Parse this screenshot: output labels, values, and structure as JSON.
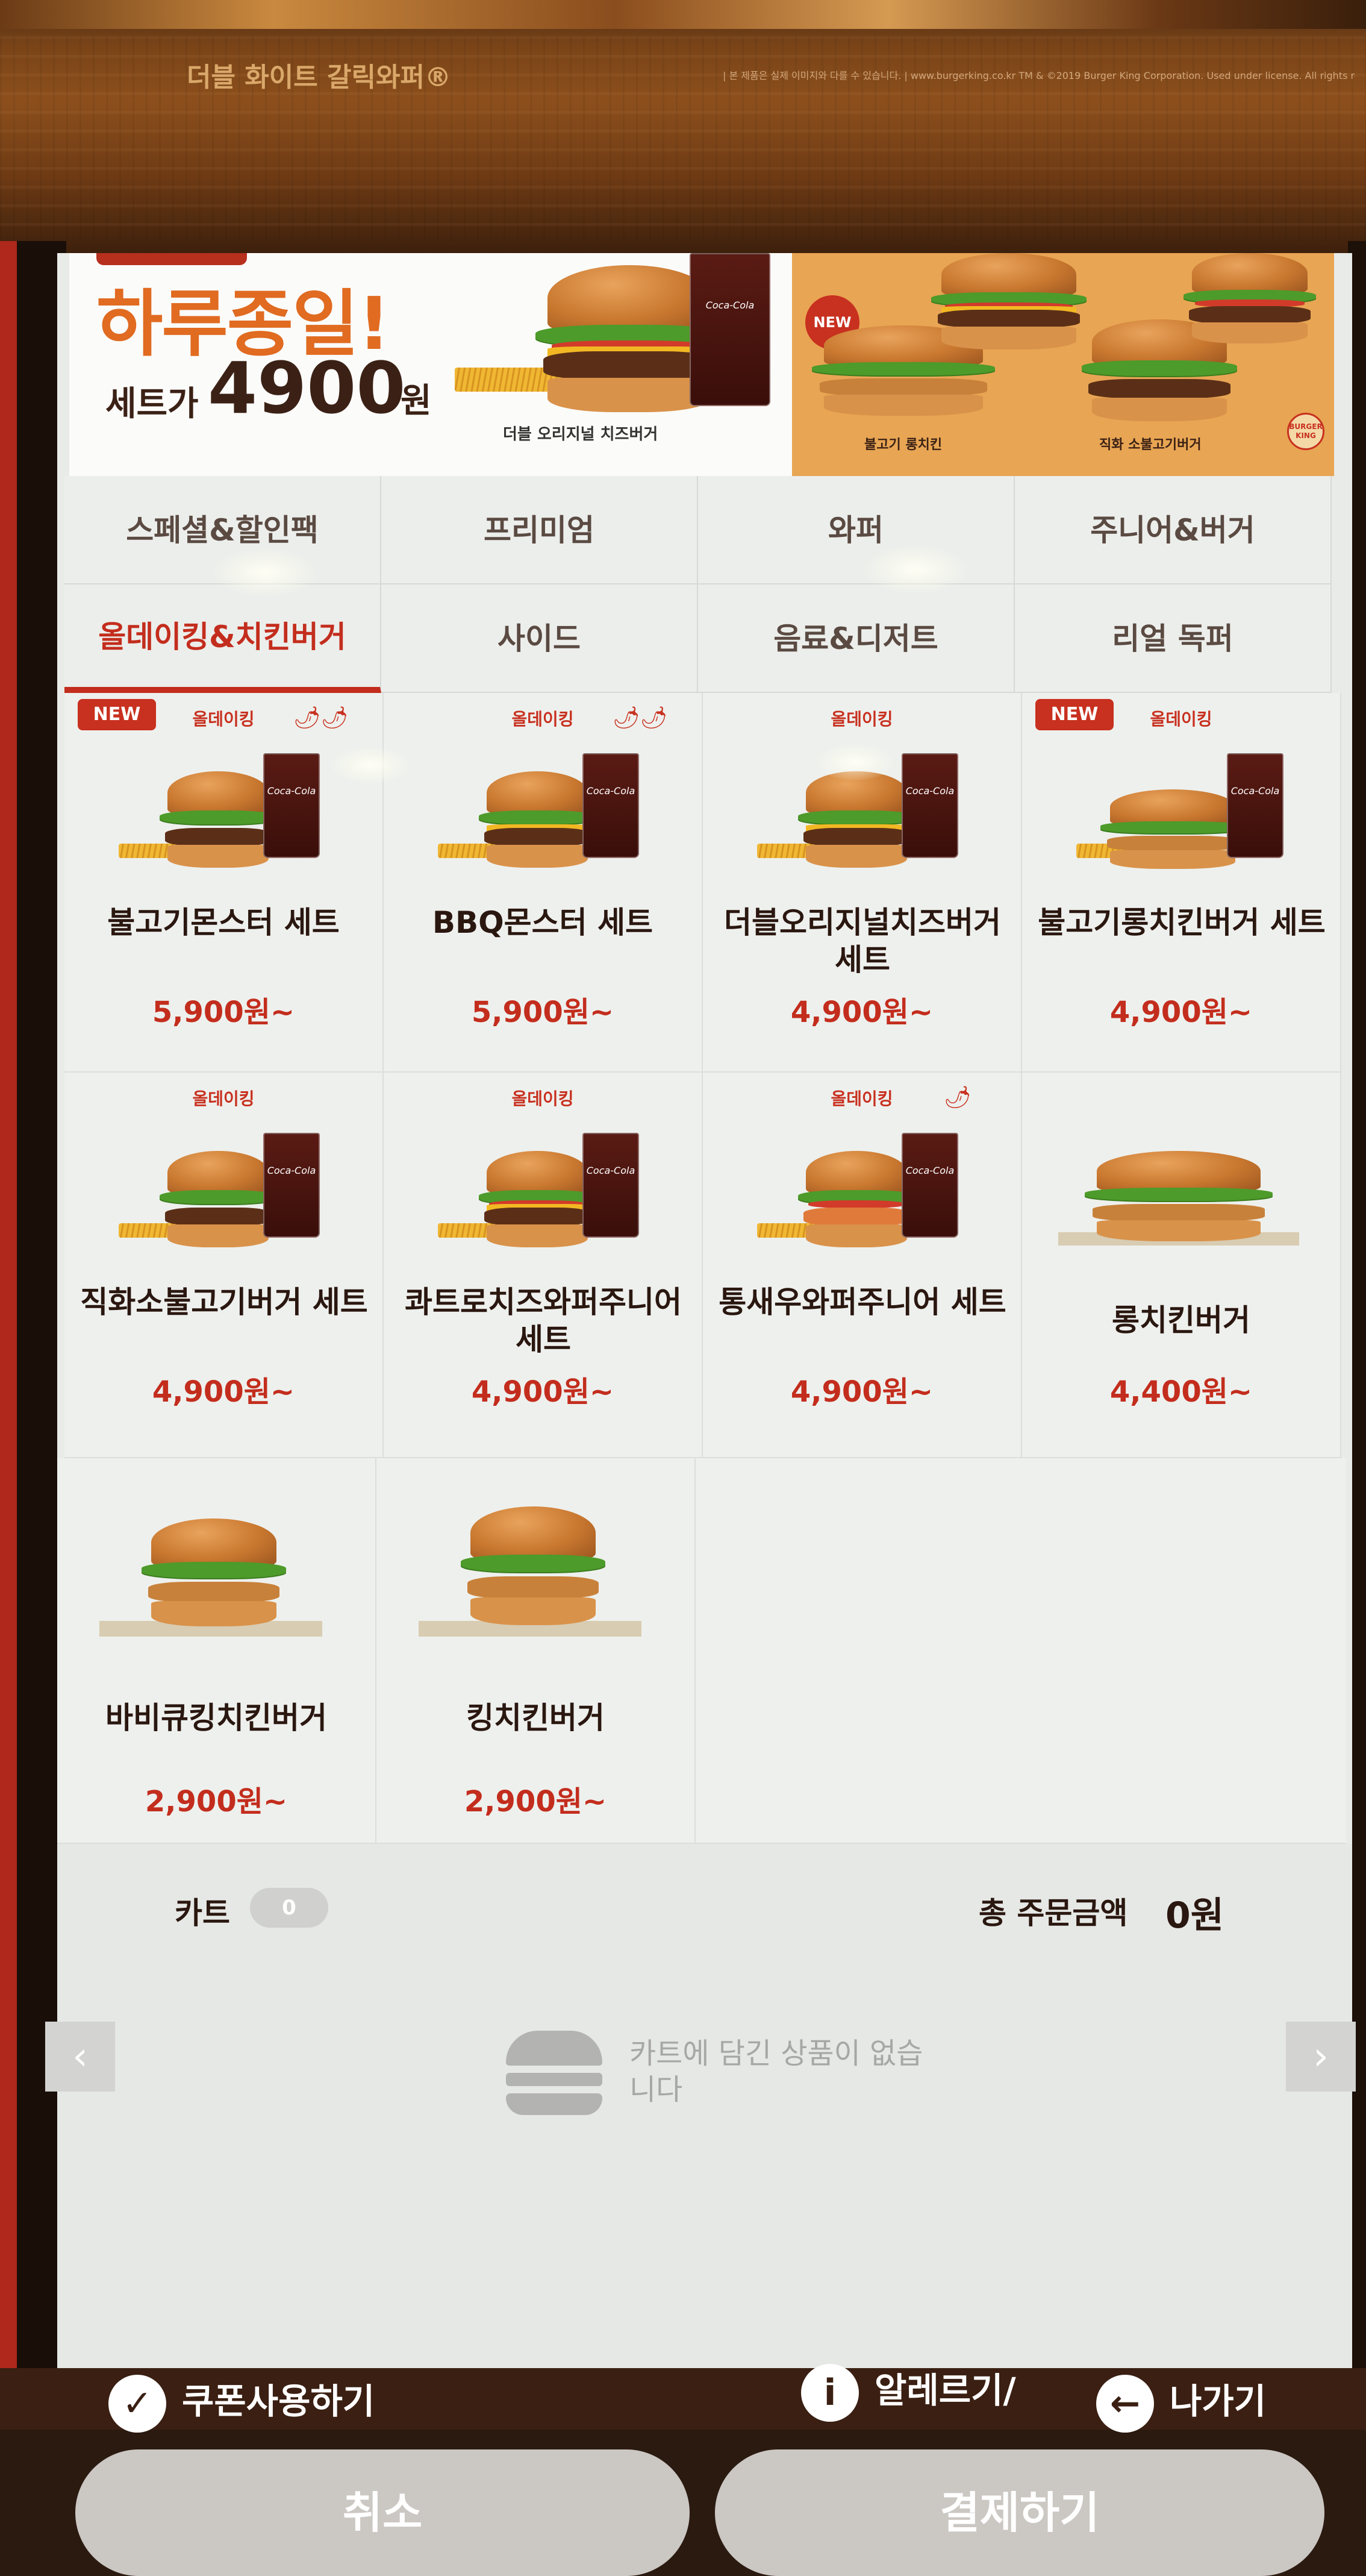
{
  "frame": {
    "promo_title": "더블 화이트 갈릭와퍼®",
    "legal_text": "| 본 제품은 실제 이미지와 다를 수 있습니다.  | www.burgerking.co.kr  TM & ©2019 Burger King Corporation. Used under license. All rights reserved."
  },
  "banner": {
    "headline": "하루종일!",
    "set_label": "세트가",
    "price": "4900",
    "price_unit": "원",
    "product_caption": "더블 오리지널 치즈버거",
    "new_badge": "NEW",
    "right_captions": [
      "불고기 롱치킨",
      "직화 소불고기버거"
    ],
    "logo_text": "BURGER KING",
    "drink_brand": "Coca-Cola"
  },
  "categories": [
    {
      "label": "스페셜&할인팩",
      "active": false
    },
    {
      "label": "프리미엄",
      "active": false
    },
    {
      "label": "와퍼",
      "active": false
    },
    {
      "label": "주니어&버거",
      "active": false
    },
    {
      "label": "올데이킹&치킨버거",
      "active": true
    },
    {
      "label": "사이드",
      "active": false
    },
    {
      "label": "음료&디저트",
      "active": false
    },
    {
      "label": "리얼 독퍼",
      "active": false
    }
  ],
  "products": [
    {
      "name": "불고기몬스터 세트",
      "price": "5,900원~",
      "new": "NEW",
      "tag": "올데이킹",
      "pepper": "🌶🌶"
    },
    {
      "name": "BBQ몬스터 세트",
      "price": "5,900원~",
      "tag": "올데이킹",
      "pepper": "🌶🌶"
    },
    {
      "name": "더블오리지널치즈버거 세트",
      "price": "4,900원~",
      "tag": "올데이킹"
    },
    {
      "name": "불고기롱치킨버거 세트",
      "price": "4,900원~",
      "new": "NEW",
      "tag": "올데이킹"
    },
    {
      "name": "직화소불고기버거 세트",
      "price": "4,900원~",
      "tag": "올데이킹"
    },
    {
      "name": "콰트로치즈와퍼주니어 세트",
      "price": "4,900원~",
      "tag": "올데이킹"
    },
    {
      "name": "통새우와퍼주니어 세트",
      "price": "4,900원~",
      "tag": "올데이킹",
      "pepper": "🌶"
    },
    {
      "name": "롱치킨버거",
      "price": "4,400원~"
    },
    {
      "name": "바비큐킹치킨버거",
      "price": "2,900원~"
    },
    {
      "name": "킹치킨버거",
      "price": "2,900원~"
    }
  ],
  "cart": {
    "label": "카트",
    "count": "0",
    "total_label": "총 주문금액",
    "total_value": "0원",
    "empty_message": "카트에 담긴 상품이 없습니다",
    "prev_arrow": "‹",
    "next_arrow": "›"
  },
  "actions": {
    "cancel": "취소",
    "pay": "결제하기"
  },
  "bottom": {
    "left_label": "쿠폰사용하기",
    "allergy_label": "알레르기/",
    "exit_label": "나가기"
  },
  "colors": {
    "accent": "#c32d1d",
    "frame_wood": "#8c4f1c",
    "screen_bg": "#e9ebe8",
    "banner_orange": "#e8a553",
    "button_disabled": "#cbc7c3"
  }
}
